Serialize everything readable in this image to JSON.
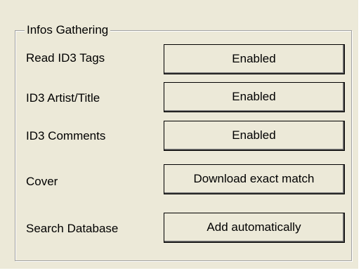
{
  "group": {
    "title": "Infos Gathering"
  },
  "rows": [
    {
      "label": "Read ID3 Tags",
      "value": "Enabled"
    },
    {
      "label": "ID3 Artist/Title",
      "value": "Enabled"
    },
    {
      "label": "ID3 Comments",
      "value": "Enabled"
    },
    {
      "label": "Cover",
      "value": "Download exact match"
    },
    {
      "label": "Search Database",
      "value": "Add automatically"
    }
  ]
}
